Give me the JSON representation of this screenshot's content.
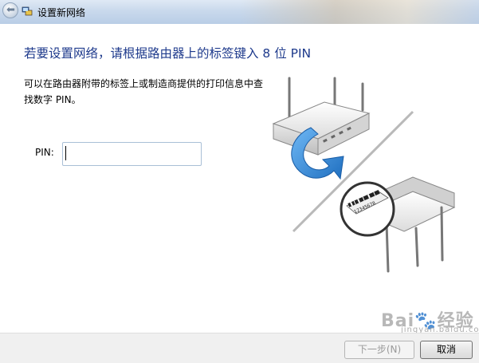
{
  "window": {
    "title": "设置新网络"
  },
  "main": {
    "heading": "若要设置网络，请根据路由器上的标签键入 8 位 PIN",
    "description": "可以在路由器附带的标签上或制造商提供的打印信息中查找数字 PIN。",
    "pin_label": "PIN:",
    "pin_value": ""
  },
  "illustration": {
    "label_code": "12345678"
  },
  "footer": {
    "next_label": "下一步(N)",
    "cancel_label": "取消"
  },
  "watermark": {
    "text": "Bai",
    "suffix": "经验",
    "sub": "jingyan.baidu.com"
  },
  "colors": {
    "heading": "#1e3a8c",
    "arrow": "#2f86d6",
    "footer_bg": "#f0f0f0"
  },
  "icons": [
    "back-arrow-icon",
    "network-setup-icon",
    "router-icon",
    "curved-arrow-icon"
  ]
}
